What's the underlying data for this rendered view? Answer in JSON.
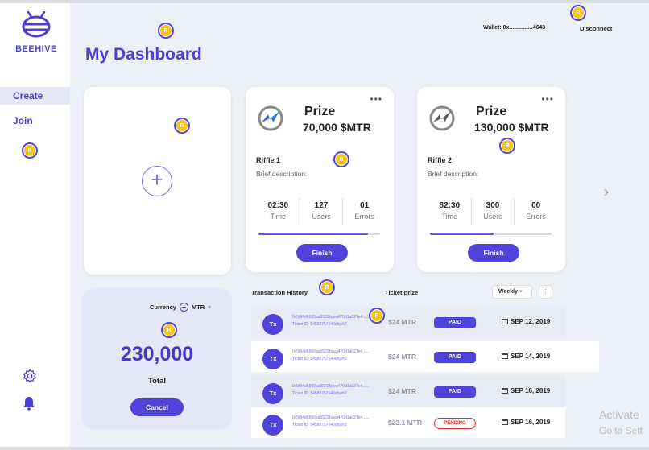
{
  "app": {
    "logo_text": "BEEHIVE"
  },
  "sidebar": {
    "items": [
      {
        "label": "Create",
        "active": true
      },
      {
        "label": "Join",
        "active": false
      }
    ]
  },
  "header": {
    "title": "My Dashboard",
    "wallet": "Wallet: 0x...............4643",
    "disconnect": "Disconnect"
  },
  "coin_label": "R",
  "prize_cards": [
    {
      "label": "Prize",
      "amount": "70,000 $MTR",
      "name": "Riffle 1",
      "description": "Brief description:",
      "stats": [
        {
          "value": "02:30",
          "label": "Time"
        },
        {
          "value": "127",
          "label": "Users"
        },
        {
          "value": "01",
          "label": "Errors"
        }
      ],
      "progress": 0.9,
      "button": "Finish"
    },
    {
      "label": "Prize",
      "amount": "130,000 $MTR",
      "name": "Riffle 2",
      "description": "Brief description:",
      "stats": [
        {
          "value": "82:30",
          "label": "Time"
        },
        {
          "value": "300",
          "label": "Users"
        },
        {
          "value": "00",
          "label": "Errors"
        }
      ],
      "progress": 0.52,
      "button": "Finish"
    }
  ],
  "currency": {
    "label": "Currency",
    "selected": "MTR",
    "total_value": "230,000",
    "total_label": "Total",
    "cancel": "Cancel"
  },
  "transactions": {
    "title": "Transaction History",
    "prize_header": "Ticket prize",
    "period": "Weekly",
    "more": "⋮",
    "rows": [
      {
        "badge": "Tx",
        "hash": "0x5f94d6560aa5522fa.ea470d1a027e4......",
        "ticket": "Ticket ID: 54580757640dhjeh2",
        "amount": "$24 MTR",
        "status": "PAID",
        "date": "SEP 12, 2019"
      },
      {
        "badge": "Tx",
        "hash": "0x5f94d6560aa5522fa.ea470d1a027e4......",
        "ticket": "Ticket ID: 54580757640dhjeh2",
        "amount": "$24 MTR",
        "status": "PAID",
        "date": "SEP 14, 2019"
      },
      {
        "badge": "Tx",
        "hash": "0x5f94d6560aa5522fa.ea470d1a027e4......",
        "ticket": "Ticket ID: 54580757640dhjeh2",
        "amount": "$24 MTR",
        "status": "PAID",
        "date": "SEP 16, 2019"
      },
      {
        "badge": "Tx",
        "hash": "0x5f94d6560aa5522fa.ea470d1a027e4......",
        "ticket": "Ticket ID: 54580757640dhjeh2",
        "amount": "$23.1 MTR",
        "status": "PENDING",
        "date": "SEP 16, 2019"
      }
    ]
  },
  "watermark": {
    "line1": "Activate",
    "line2": "Go to Sett"
  },
  "colors": {
    "accent": "#4f43dc",
    "title": "#4b3fd8",
    "coin": "#f7c51c",
    "pending": "#e03030"
  }
}
